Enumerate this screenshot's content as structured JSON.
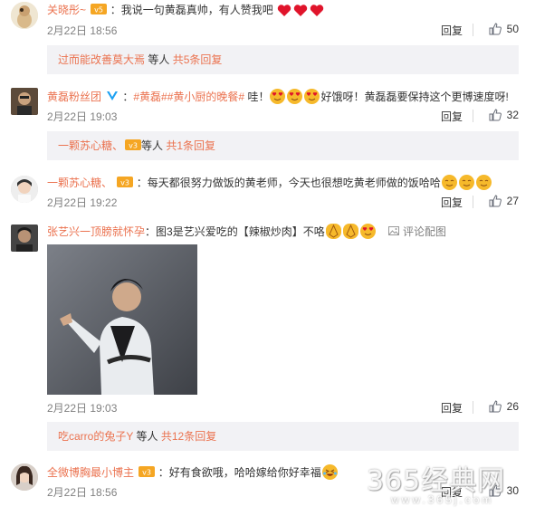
{
  "comments": [
    {
      "user": "关晓彤~",
      "text": "：我说一句黄磊真帅，有人赞我吧",
      "date": "2月22日 18:56",
      "reply_label": "回复",
      "likes": "50",
      "sub": {
        "user": "过而能改善莫大焉",
        "etc": "等人",
        "total": "共5条回复"
      }
    },
    {
      "user": "黄磊粉丝团",
      "tag1": "#黄磊#",
      "tag2": "#黄小厨的晚餐#",
      "text_a": "哇！",
      "text_b": "好饿呀！黄磊磊要保持这个更博速度呀!",
      "date": "2月22日 19:03",
      "reply_label": "回复",
      "likes": "32",
      "sub": {
        "user": "一颗苏心糖、",
        "etc": "等人",
        "total": "共1条回复"
      }
    },
    {
      "user": "一颗苏心糖、",
      "text": "：每天都很努力做饭的黄老师，今天也很想吃黄老师做的饭哈哈",
      "date": "2月22日 19:22",
      "reply_label": "回复",
      "likes": "27"
    },
    {
      "user": "张艺兴一顶膀就怀孕",
      "text": "：图3是艺兴爱吃的【辣椒炒肉】不咯",
      "img_ctl": "评论配图",
      "date": "2月22日 19:03",
      "reply_label": "回复",
      "likes": "26",
      "sub": {
        "user": "吃carro的兔子Y",
        "etc": "等人",
        "total": "共12条回复"
      }
    },
    {
      "user": "全微博胸最小博主",
      "text": "：好有食欲哦，哈哈嫁给你好幸福",
      "date": "2月22日 18:56",
      "reply_label": "回复",
      "likes": "30"
    }
  ],
  "watermark": "365经典网",
  "watermark_url": "www.365j.com",
  "colors": {
    "link": "#eb7350",
    "subbox": "#f2f2f5",
    "meta": "#808080"
  }
}
